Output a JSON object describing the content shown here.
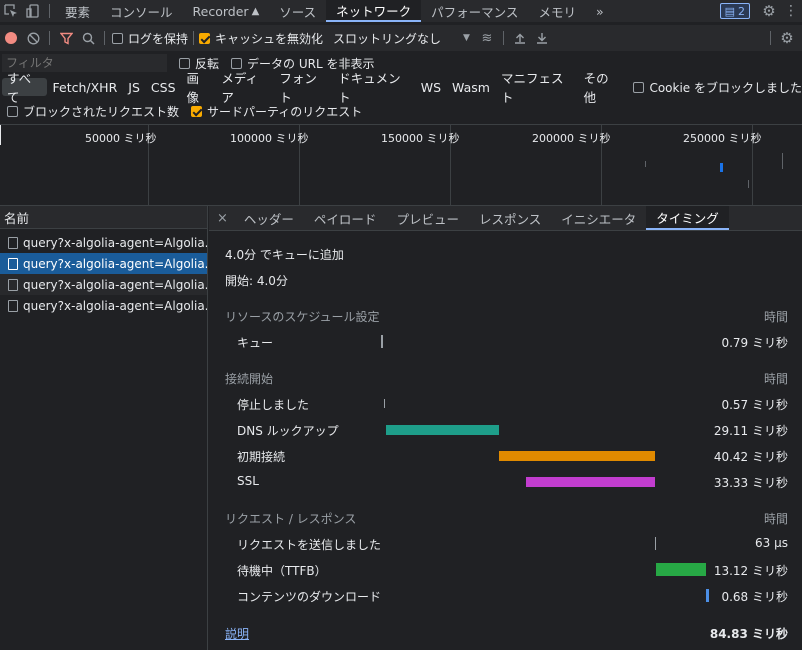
{
  "top_tabs": {
    "items": [
      "要素",
      "コンソール",
      "Recorder",
      "ソース",
      "ネットワーク",
      "パフォーマンス",
      "メモリ"
    ],
    "more": "»",
    "issues_count": "2"
  },
  "toolbar": {
    "preserve_log": "ログを保持",
    "disable_cache": "キャッシュを無効化",
    "throttling": "スロットリングなし"
  },
  "filter": {
    "placeholder": "フィルタ",
    "invert": "反転",
    "hide_data_urls": "データの URL を非表示"
  },
  "types": [
    "すべて",
    "Fetch/XHR",
    "JS",
    "CSS",
    "画像",
    "メディア",
    "フォント",
    "ドキュメント",
    "WS",
    "Wasm",
    "マニフェスト",
    "その他"
  ],
  "blocked_cookies": "Cookie をブロックしました",
  "blocked_requests": "ブロックされたリクエスト数",
  "third_party": "サードパーティのリクエスト",
  "overview": {
    "ticks": [
      "50000 ミリ秒",
      "100000 ミリ秒",
      "150000 ミリ秒",
      "200000 ミリ秒",
      "250000 ミリ秒"
    ]
  },
  "requests": {
    "header": "名前",
    "items": [
      "query?x-algolia-agent=Algolia...",
      "query?x-algolia-agent=Algolia...",
      "query?x-algolia-agent=Algolia...",
      "query?x-algolia-agent=Algolia..."
    ]
  },
  "detail_tabs": [
    "ヘッダー",
    "ペイロード",
    "プレビュー",
    "レスポンス",
    "イニシエータ",
    "タイミング"
  ],
  "timing": {
    "queued": "4.0分 でキューに追加",
    "started": "開始: 4.0分",
    "sections": {
      "scheduling": "リソースのスケジュール設定",
      "connection": "接続開始",
      "request": "リクエスト / レスポンス",
      "time": "時間"
    },
    "rows": [
      {
        "label": "キュー",
        "value": "0.79 ミリ秒"
      },
      {
        "label": "停止しました",
        "value": "0.57 ミリ秒"
      },
      {
        "label": "DNS ルックアップ",
        "value": "29.11 ミリ秒"
      },
      {
        "label": "初期接続",
        "value": "40.42 ミリ秒"
      },
      {
        "label": "SSL",
        "value": "33.33 ミリ秒"
      },
      {
        "label": "リクエストを送信しました",
        "value": "63 μs"
      },
      {
        "label": "待機中（TTFB）",
        "value": "13.12 ミリ秒"
      },
      {
        "label": "コンテンツのダウンロード",
        "value": "0.68 ミリ秒"
      }
    ],
    "explanation": "説明",
    "total": "84.83 ミリ秒"
  },
  "colors": {
    "dns": "#1e9e8a",
    "connect": "#e08a00",
    "ssl": "#c23dcf",
    "ttfb": "#27a845",
    "download": "#4c8fe6",
    "accent": "#8ab4f8"
  }
}
